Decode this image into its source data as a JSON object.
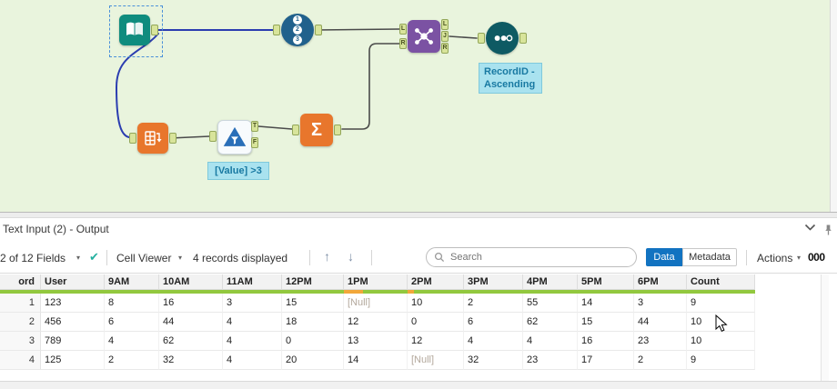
{
  "colors": {
    "canvas_bg": "#e9f4dd",
    "wire_blue": "#2b3db0",
    "wire_dark": "#4a4a4a",
    "tool_teal": "#0f8c7e",
    "tool_blue": "#21618c",
    "tool_purple": "#7b52a3",
    "tool_dark_teal": "#0e5a63",
    "tool_orange": "#e8762c",
    "filter_blue": "#2a6fb8",
    "annotation_bg": "#a9e2ef",
    "annotation_text": "#1879a2",
    "quality_green": "#92c83e",
    "quality_orange": "#f2a73a",
    "data_button_blue": "#1273c1",
    "null_text": "#b3a89c"
  },
  "canvas": {
    "record_id_digits": [
      "1",
      "2",
      "3"
    ],
    "summarize_glyph": "Σ",
    "anchors": {
      "join_in": [
        "L",
        "R"
      ],
      "join_out": [
        "L",
        "J",
        "R"
      ],
      "filter_out": [
        "T",
        "F"
      ]
    },
    "annotations": {
      "sort_line1": "RecordID -",
      "sort_line2": "Ascending",
      "filter": "[Value] >3"
    }
  },
  "results": {
    "title": "Text Input (2) - Output",
    "toolbar": {
      "fields_summary": "2 of 12 Fields",
      "cell_viewer_label": "Cell Viewer",
      "records_displayed": "4 records displayed",
      "search_placeholder": "Search",
      "data_label": "Data",
      "metadata_label": "Metadata",
      "actions_label": "Actions",
      "counter": "000"
    },
    "icons": {
      "dropdown_caret": "▾",
      "check": "✔",
      "arrow_up": "↑",
      "arrow_down": "↓"
    },
    "table": {
      "columns": [
        "ord",
        "User",
        "9AM",
        "10AM",
        "11AM",
        "12PM",
        "1PM",
        "2PM",
        "3PM",
        "4PM",
        "5PM",
        "6PM",
        "Count"
      ],
      "quality_orange": [
        0,
        0,
        0,
        0,
        0,
        0,
        0.3,
        0.12,
        0,
        0,
        0,
        0,
        0
      ],
      "rows": [
        [
          "1",
          "123",
          "8",
          "16",
          "3",
          "15",
          "[Null]",
          "10",
          "2",
          "55",
          "14",
          "3",
          "9"
        ],
        [
          "2",
          "456",
          "6",
          "44",
          "4",
          "18",
          "12",
          "0",
          "6",
          "62",
          "15",
          "44",
          "10"
        ],
        [
          "3",
          "789",
          "4",
          "62",
          "4",
          "0",
          "13",
          "12",
          "4",
          "4",
          "16",
          "23",
          "10"
        ],
        [
          "4",
          "125",
          "2",
          "32",
          "4",
          "20",
          "14",
          "[Null]",
          "32",
          "23",
          "17",
          "2",
          "9"
        ]
      ]
    }
  }
}
